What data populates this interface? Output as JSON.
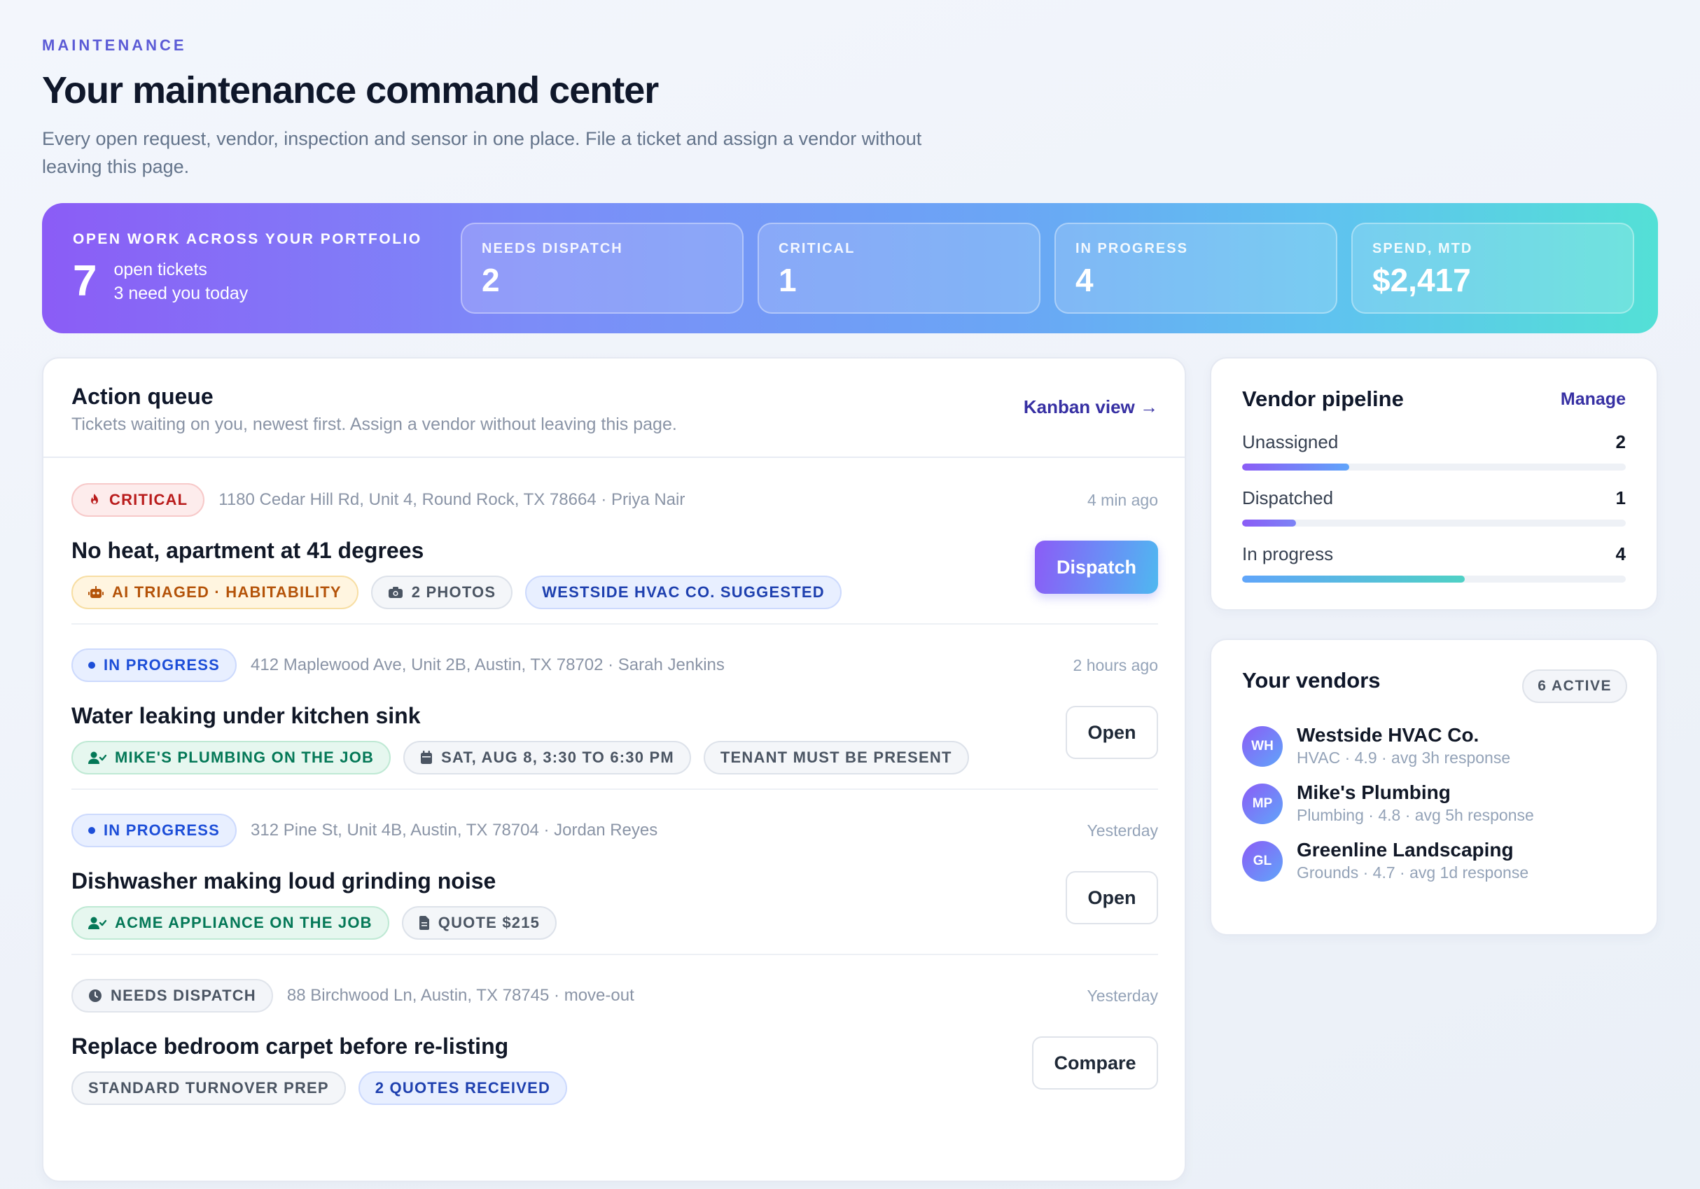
{
  "header": {
    "eyebrow": "MAINTENANCE",
    "title": "Your maintenance command center",
    "subtitle": "Every open request, vendor, inspection and sensor in one place. File a ticket and assign a vendor without leaving this page."
  },
  "banner": {
    "eyebrow": "OPEN WORK ACROSS YOUR PORTFOLIO",
    "open_count": "7",
    "open_label": "open tickets",
    "open_sub": "3 need you today",
    "stats": [
      {
        "label": "NEEDS DISPATCH",
        "value": "2"
      },
      {
        "label": "CRITICAL",
        "value": "1"
      },
      {
        "label": "IN PROGRESS",
        "value": "4"
      },
      {
        "label": "SPEND, MTD",
        "value": "$2,417"
      }
    ]
  },
  "queue": {
    "title": "Action queue",
    "description": "Tickets waiting on you, newest first. Assign a vendor without leaving this page.",
    "kanban_link": "Kanban view →",
    "tickets": [
      {
        "status": "CRITICAL",
        "address": "1180 Cedar Hill Rd, Unit 4, Round Rock, TX 78664 · Priya Nair",
        "time": "4 min ago",
        "title": "No heat, apartment at 41 degrees",
        "tags": [
          "AI TRIAGED · HABITABILITY",
          "2 PHOTOS",
          "WESTSIDE HVAC CO. SUGGESTED"
        ],
        "action": "Dispatch"
      },
      {
        "status": "IN PROGRESS",
        "address": "412 Maplewood Ave, Unit 2B, Austin, TX 78702 · Sarah Jenkins",
        "time": "2 hours ago",
        "title": "Water leaking under kitchen sink",
        "tags": [
          "MIKE'S PLUMBING ON THE JOB",
          "SAT, AUG 8, 3:30 TO 6:30 PM",
          "TENANT MUST BE PRESENT"
        ],
        "action": "Open"
      },
      {
        "status": "IN PROGRESS",
        "address": "312 Pine St, Unit 4B, Austin, TX 78704 · Jordan Reyes",
        "time": "Yesterday",
        "title": "Dishwasher making loud grinding noise",
        "tags": [
          "ACME APPLIANCE ON THE JOB",
          "QUOTE $215"
        ],
        "action": "Open"
      },
      {
        "status": "NEEDS DISPATCH",
        "address": "88 Birchwood Ln, Austin, TX 78745 · move-out",
        "time": "Yesterday",
        "title": "Replace bedroom carpet before re-listing",
        "tags": [
          "STANDARD TURNOVER PREP",
          "2 QUOTES RECEIVED"
        ],
        "action": "Compare"
      }
    ]
  },
  "pipeline": {
    "title": "Vendor pipeline",
    "manage": "Manage",
    "rows": [
      {
        "label": "Unassigned",
        "count": "2",
        "fill": 0.28
      },
      {
        "label": "Dispatched",
        "count": "1",
        "fill": 0.14
      },
      {
        "label": "In progress",
        "count": "4",
        "fill": 0.58
      }
    ]
  },
  "vendors": {
    "title": "Your vendors",
    "badge": "6 ACTIVE",
    "items": [
      {
        "initials": "WH",
        "name": "Westside HVAC Co.",
        "meta": "HVAC · 4.9 · avg 3h response"
      },
      {
        "initials": "MP",
        "name": "Mike's Plumbing",
        "meta": "Plumbing · 4.8 · avg 5h response"
      },
      {
        "initials": "GL",
        "name": "Greenline Landscaping",
        "meta": "Grounds · 4.7 · avg 1d response"
      }
    ]
  },
  "colors": {
    "accent": "#5b5bd6",
    "critical": "#b91c1c",
    "progress": "#1d4ed8",
    "success": "#047857",
    "warning": "#b45309"
  }
}
